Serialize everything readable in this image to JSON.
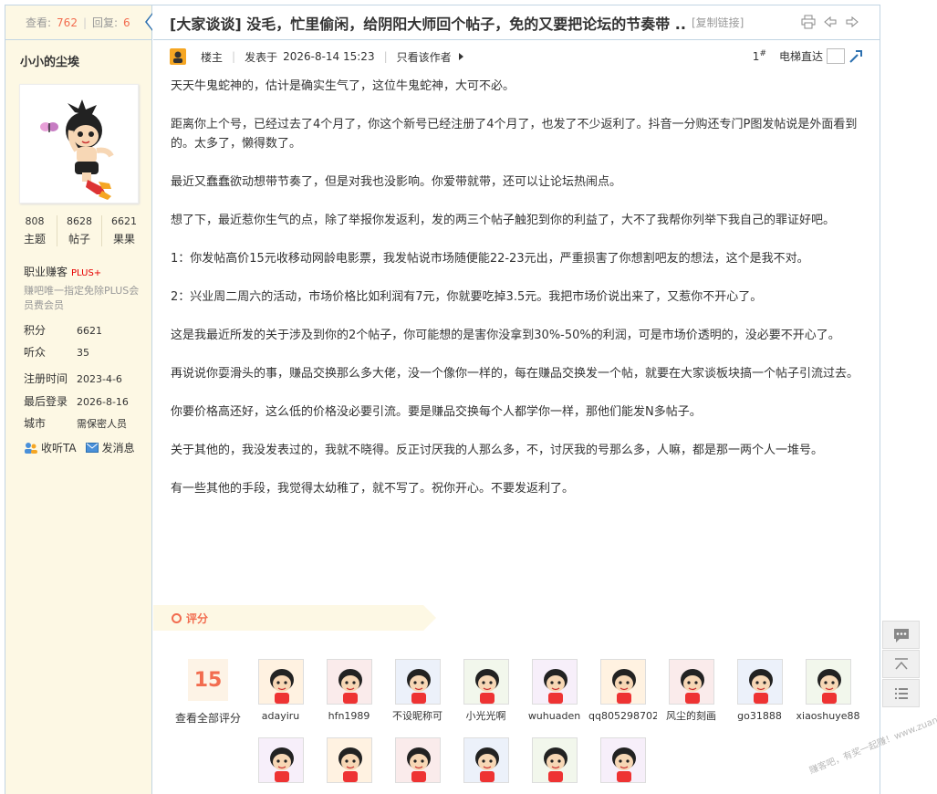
{
  "sidebar": {
    "views_label": "查看:",
    "views": "762",
    "replies_label": "回复:",
    "replies": "6",
    "username": "小小的尘埃",
    "stats": [
      {
        "value": "808",
        "label": "主题"
      },
      {
        "value": "8628",
        "label": "帖子"
      },
      {
        "value": "6621",
        "label": "果果"
      }
    ],
    "rank": "职业赚客",
    "rank_badge": "PLUS+",
    "desc": "赚吧唯一指定免除PLUS会员费会员",
    "score_label": "积分",
    "score": "6621",
    "fans_label": "听众",
    "fans": "35",
    "register_label": "注册时间",
    "register": "2023-4-6",
    "last_login_label": "最后登录",
    "last_login": "2026-8-16",
    "city_label": "城市",
    "city": "需保密人员",
    "listen_label": "收听TA",
    "message_label": "发消息"
  },
  "post": {
    "title": "[大家谈谈] 没毛，忙里偷闲，给阴阳大师回个帖子，免的又要把论坛的节奏带 ..",
    "copy_link": "[复制链接]",
    "floor_label": "楼主",
    "posted_prefix": "发表于",
    "posted_time": "2026-8-14 15:23",
    "only_author": "只看该作者",
    "floor_no": "1",
    "floor_sup": "#",
    "jump_label": "电梯直达",
    "paragraphs": [
      "天天牛鬼蛇神的，估计是确实生气了，这位牛鬼蛇神，大可不必。",
      "距离你上个号，已经过去了4个月了，你这个新号已经注册了4个月了，也发了不少返利了。抖音一分购还专门P图发帖说是外面看到的。太多了，懒得数了。",
      "最近又蠢蠢欲动想带节奏了，但是对我也没影响。你爱带就带，还可以让论坛热闹点。",
      "想了下，最近惹你生气的点，除了举报你发返利，发的两三个帖子触犯到你的利益了，大不了我帮你列举下我自己的罪证好吧。",
      "1：你发帖高价15元收移动网龄电影票，我发帖说市场随便能22-23元出，严重损害了你想割吧友的想法，这个是我不对。",
      "2：兴业周二周六的活动，市场价格比如利润有7元，你就要吃掉3.5元。我把市场价说出来了，又惹你不开心了。",
      "这是我最近所发的关于涉及到你的2个帖子，你可能想的是害你没拿到30%-50%的利润，可是市场价透明的，没必要不开心了。",
      "再说说你耍滑头的事，赚品交换那么多大佬，没一个像你一样的，每在赚品交换发一个帖，就要在大家谈板块搞一个帖子引流过去。",
      "你要价格高还好，这么低的价格没必要引流。要是赚品交换每个人都学你一样，那他们能发N多帖子。",
      "关于其他的，我没发表过的，我就不晓得。反正讨厌我的人那么多，不，讨厌我的号那么多，人嘛，都是那一两个人一堆号。",
      "有一些其他的手段，我觉得太幼稚了，就不写了。祝你开心。不要发返利了。"
    ]
  },
  "rating": {
    "label": "评分",
    "total": "15",
    "view_all": "查看全部评分",
    "raters": [
      "adayiru",
      "hfn1989",
      "不设昵称可",
      "小光光啊",
      "wuhuaden",
      "qq805298702",
      "风尘的刻画",
      "go31888",
      "xiaoshuye88",
      "",
      "",
      "",
      "",
      "",
      ""
    ]
  },
  "watermark": "赚客吧，有奖一起赚！www.zuanke8.com",
  "colors": {
    "accent": "#f26c4f",
    "border": "#c2d5e3",
    "sidebar_bg": "#fdf8e4",
    "link": "#2b6faf"
  }
}
